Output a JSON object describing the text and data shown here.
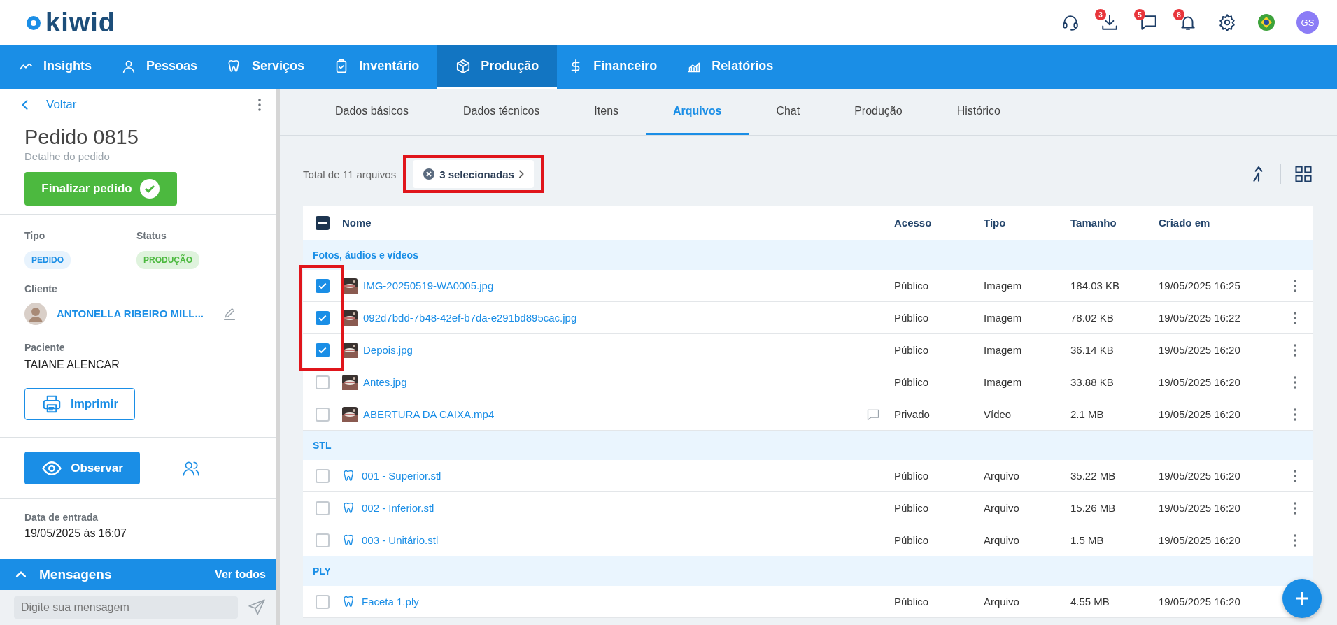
{
  "header": {
    "logo": "kiwid",
    "icons": [
      {
        "kind": "support"
      },
      {
        "kind": "download",
        "badge": "3"
      },
      {
        "kind": "chat",
        "badge": "5"
      },
      {
        "kind": "bell",
        "badge": "8"
      },
      {
        "kind": "settings"
      },
      {
        "kind": "flag"
      },
      {
        "kind": "avatar",
        "label": "GS"
      }
    ]
  },
  "nav": [
    {
      "label": "Insights",
      "kind": "chart",
      "selected": false
    },
    {
      "label": "Pessoas",
      "kind": "person",
      "selected": false
    },
    {
      "label": "Serviços",
      "kind": "tooth",
      "selected": false
    },
    {
      "label": "Inventário",
      "kind": "clipboard",
      "selected": false
    },
    {
      "label": "Produção",
      "kind": "box",
      "selected": true
    },
    {
      "label": "Financeiro",
      "kind": "dollar",
      "selected": false
    },
    {
      "label": "Relatórios",
      "kind": "report",
      "selected": false
    }
  ],
  "sidebar": {
    "back": "Voltar",
    "title": "Pedido 0815",
    "subtitle": "Detalhe do pedido",
    "finalize": "Finalizar pedido",
    "type_label": "Tipo",
    "type_value": "PEDIDO",
    "status_label": "Status",
    "status_value": "PRODUÇÃO",
    "client_label": "Cliente",
    "client_name": "ANTONELLA RIBEIRO MILL...",
    "patient_label": "Paciente",
    "patient_name": "TAIANE ALENCAR",
    "print": "Imprimir",
    "observe": "Observar",
    "entry_label": "Data de entrada",
    "entry_value": "19/05/2025 às 16:07"
  },
  "messages": {
    "title": "Mensagens",
    "link": "Ver todos",
    "placeholder": "Digite sua mensagem"
  },
  "tabs": [
    {
      "label": "Dados básicos",
      "selected": false
    },
    {
      "label": "Dados técnicos",
      "selected": false
    },
    {
      "label": "Itens",
      "selected": false
    },
    {
      "label": "Arquivos",
      "selected": true
    },
    {
      "label": "Chat",
      "selected": false
    },
    {
      "label": "Produção",
      "selected": false
    },
    {
      "label": "Histórico",
      "selected": false
    }
  ],
  "toolbar": {
    "total": "Total de 11 arquivos",
    "selection": {
      "label": "3 selecionadas",
      "highlighted": true
    }
  },
  "table": {
    "columns": [
      "Nome",
      "Acesso",
      "Tipo",
      "Tamanho",
      "Criado em"
    ],
    "select_all_indeterminate": true,
    "highlight_selected": true,
    "groups": [
      {
        "name": "Fotos, áudios e vídeos",
        "rows": [
          {
            "name": "IMG-20250519-WA0005.jpg",
            "kind": "picture",
            "has_comment": false,
            "access": "Público",
            "type": "Imagem",
            "size": "184.03 KB",
            "created": "19/05/2025 16:25",
            "selected": true
          },
          {
            "name": "092d7bdd-7b48-42ef-b7da-e291bd895cac.jpg",
            "kind": "picture",
            "has_comment": false,
            "access": "Público",
            "type": "Imagem",
            "size": "78.02 KB",
            "created": "19/05/2025 16:22",
            "selected": true
          },
          {
            "name": "Depois.jpg",
            "kind": "picture",
            "has_comment": false,
            "access": "Público",
            "type": "Imagem",
            "size": "36.14 KB",
            "created": "19/05/2025 16:20",
            "selected": true
          },
          {
            "name": "Antes.jpg",
            "kind": "picture",
            "has_comment": false,
            "access": "Público",
            "type": "Imagem",
            "size": "33.88 KB",
            "created": "19/05/2025 16:20",
            "selected": false
          },
          {
            "name": "ABERTURA DA CAIXA.mp4",
            "kind": "picture",
            "has_comment": true,
            "access": "Privado",
            "type": "Vídeo",
            "size": "2.1 MB",
            "created": "19/05/2025 16:20",
            "selected": false
          }
        ]
      },
      {
        "name": "STL",
        "rows": [
          {
            "name": "001 - Superior.stl",
            "kind": "tooth",
            "has_comment": false,
            "access": "Público",
            "type": "Arquivo",
            "size": "35.22 MB",
            "created": "19/05/2025 16:20",
            "selected": false
          },
          {
            "name": "002 - Inferior.stl",
            "kind": "tooth",
            "has_comment": false,
            "access": "Público",
            "type": "Arquivo",
            "size": "15.26 MB",
            "created": "19/05/2025 16:20",
            "selected": false
          },
          {
            "name": "003 - Unitário.stl",
            "kind": "tooth",
            "has_comment": false,
            "access": "Público",
            "type": "Arquivo",
            "size": "1.5 MB",
            "created": "19/05/2025 16:20",
            "selected": false
          }
        ]
      },
      {
        "name": "PLY",
        "rows": [
          {
            "name": "Faceta 1.ply",
            "kind": "tooth",
            "has_comment": false,
            "access": "Público",
            "type": "Arquivo",
            "size": "4.55 MB",
            "created": "19/05/2025 16:20",
            "selected": false
          }
        ]
      }
    ]
  }
}
